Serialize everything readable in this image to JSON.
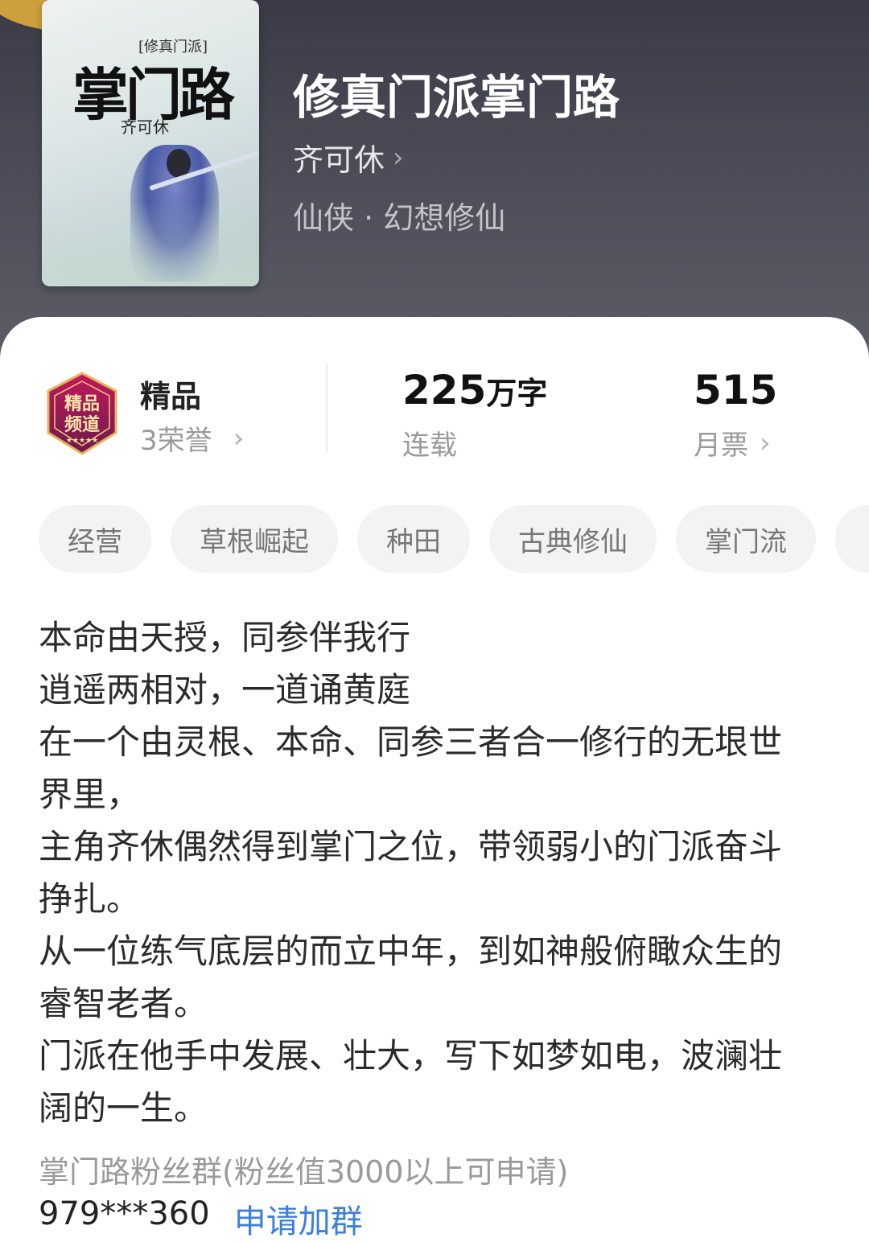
{
  "colors": {
    "header_bg": "#4a4b55",
    "accent_link": "#3d7fd8",
    "tag_bg": "#f3f3f3"
  },
  "book": {
    "title": "修真门派掌门路",
    "author": "齐可休",
    "genre": "仙侠 · 幻想修仙",
    "cover": {
      "series_label": "[修真门派]",
      "title_art": "掌门路",
      "author_art": "齐可休"
    }
  },
  "stats": {
    "badge_icon": "jingpin-pindao-badge-icon",
    "badge_text": "精品频道",
    "quality_label": "精品",
    "honors_label": "3荣誉",
    "word_count_number": "225",
    "word_count_unit": "万字",
    "status_label": "连载",
    "monthly_votes": "515",
    "monthly_votes_label": "月票"
  },
  "tags": [
    "经营",
    "草根崛起",
    "种田",
    "古典修仙",
    "掌门流"
  ],
  "description": [
    "本命由天授，同参伴我行",
    "逍遥两相对，一道诵黄庭",
    "在一个由灵根、本命、同参三者合一修行的无垠世界里，",
    "主角齐休偶然得到掌门之位，带领弱小的门派奋斗挣扎。",
    "从一位练气底层的而立中年，到如神般俯瞰众生的睿智老者。",
    "门派在他手中发展、壮大，写下如梦如电，波澜壮阔的一生。"
  ],
  "fan_group": {
    "label": "掌门路粉丝群(粉丝值3000以上可申请)",
    "number": "979***360",
    "apply_label": "申请加群"
  }
}
